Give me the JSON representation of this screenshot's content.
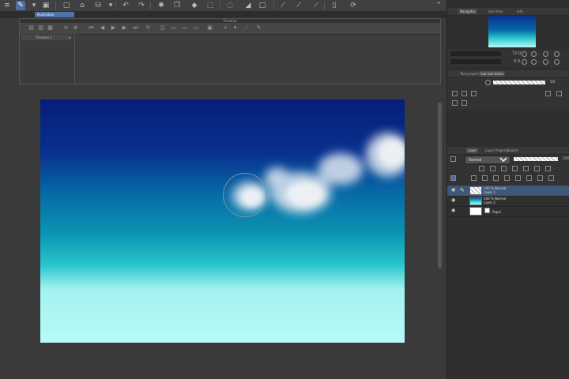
{
  "canvas_tab": {
    "label": "Illustration"
  },
  "timeline": {
    "title": "Timeline",
    "track_select": "Timeline 1"
  },
  "navigator": {
    "tabs": [
      "Navigator",
      "Sub View",
      "Info"
    ],
    "zoom": "72.0",
    "rotation": "0.0"
  },
  "tool_property": {
    "tabs": [
      "Tool property",
      "Sub tool detail"
    ],
    "size_label": "Brush Size",
    "opacity": "50"
  },
  "layer_panel": {
    "tabs": [
      "Layer",
      "Layer Property",
      "Search"
    ],
    "blend_mode": "Normal",
    "opacity": "100",
    "layers": [
      {
        "meta": "100 % Normal",
        "name": "Layer 1"
      },
      {
        "meta": "100 % Normal",
        "name": "Layer 2"
      },
      {
        "meta": "",
        "name": "Paper"
      }
    ]
  },
  "colors": {
    "accent": "#4b6fa6",
    "selected_layer": "#3f5778"
  }
}
